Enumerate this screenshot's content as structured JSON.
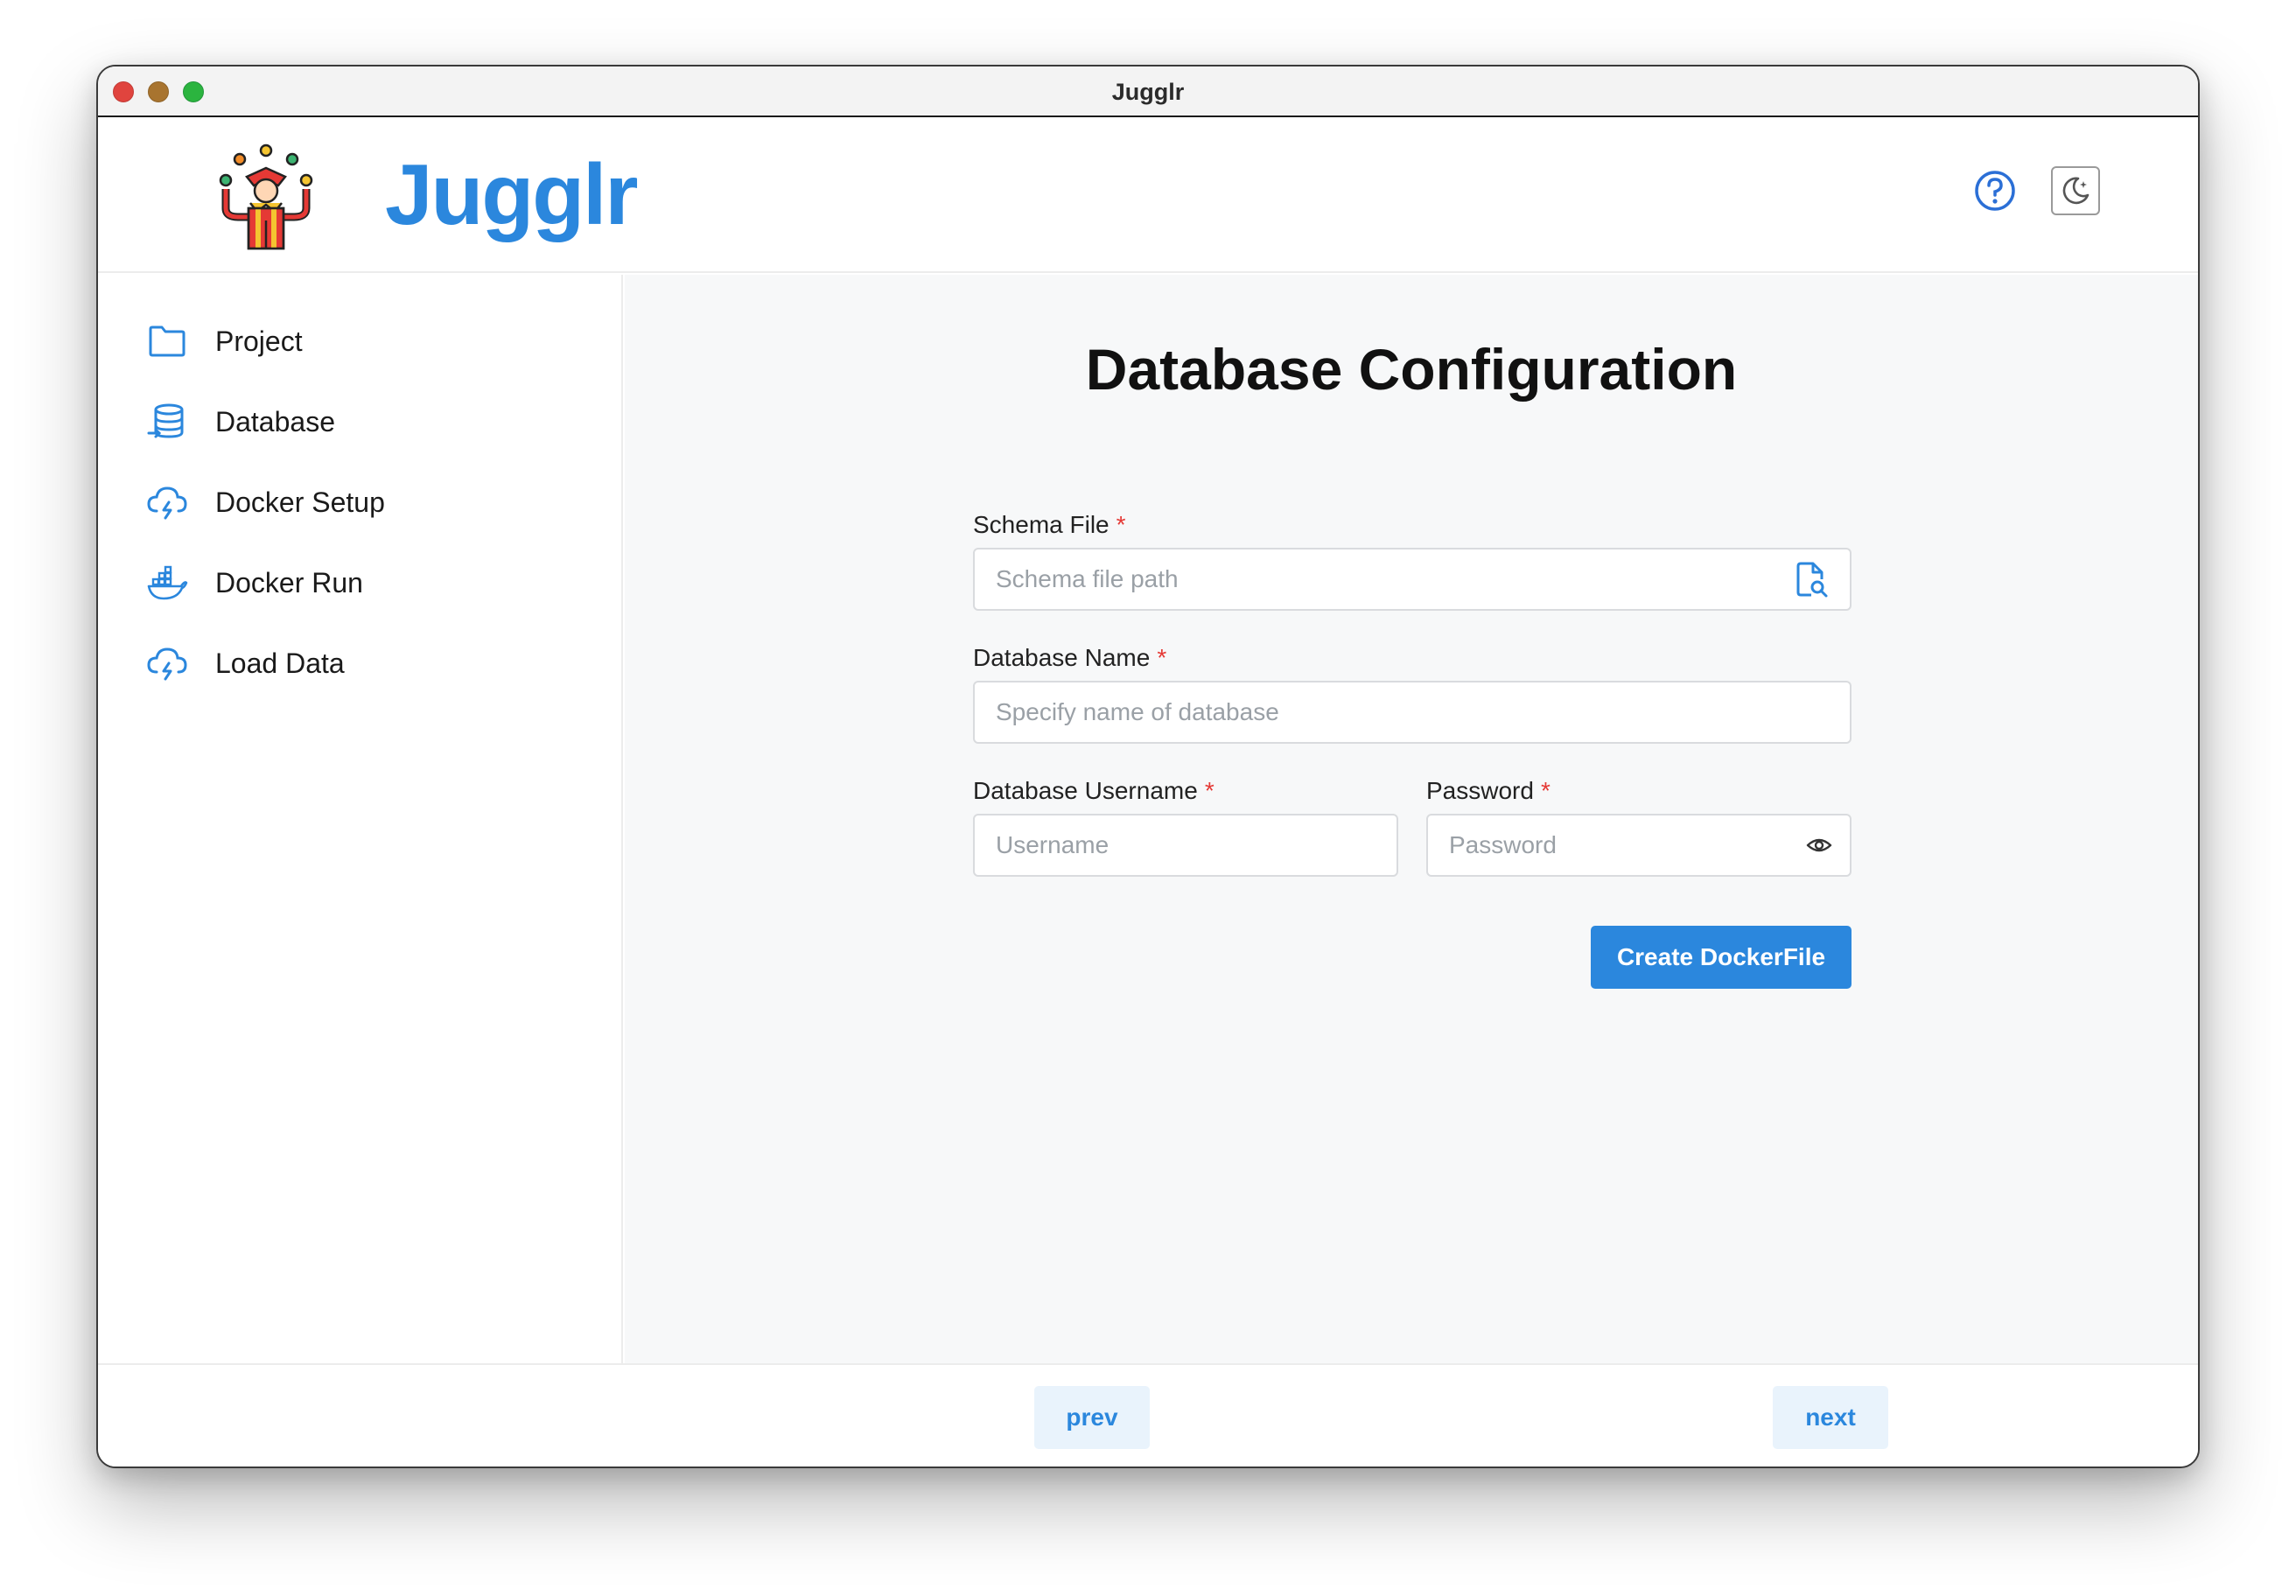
{
  "window": {
    "title": "Jugglr"
  },
  "header": {
    "brand": "Jugglr",
    "logo_icon": "juggler-logo-icon",
    "help_icon": "help-circle-icon",
    "theme_icon": "moon-star-icon"
  },
  "sidebar": {
    "items": [
      {
        "label": "Project",
        "icon": "folder-icon"
      },
      {
        "label": "Database",
        "icon": "database-import-icon"
      },
      {
        "label": "Docker Setup",
        "icon": "cloud-lightning-icon"
      },
      {
        "label": "Docker Run",
        "icon": "docker-icon"
      },
      {
        "label": "Load Data",
        "icon": "cloud-lightning-icon"
      }
    ]
  },
  "main": {
    "title": "Database Configuration",
    "schema_file": {
      "label": "Schema File",
      "required": "*",
      "placeholder": "Schema file path",
      "value": ""
    },
    "database_name": {
      "label": "Database Name",
      "required": "*",
      "placeholder": "Specify name of database",
      "value": ""
    },
    "username": {
      "label": "Database Username",
      "required": "*",
      "placeholder": "Username",
      "value": ""
    },
    "password": {
      "label": "Password",
      "required": "*",
      "placeholder": "Password",
      "value": ""
    },
    "create_button": "Create DockerFile"
  },
  "footer": {
    "prev": "prev",
    "next": "next"
  },
  "colors": {
    "accent": "#2b87dd",
    "required": "#e53935",
    "nav_button_bg": "#e9f3fc"
  }
}
